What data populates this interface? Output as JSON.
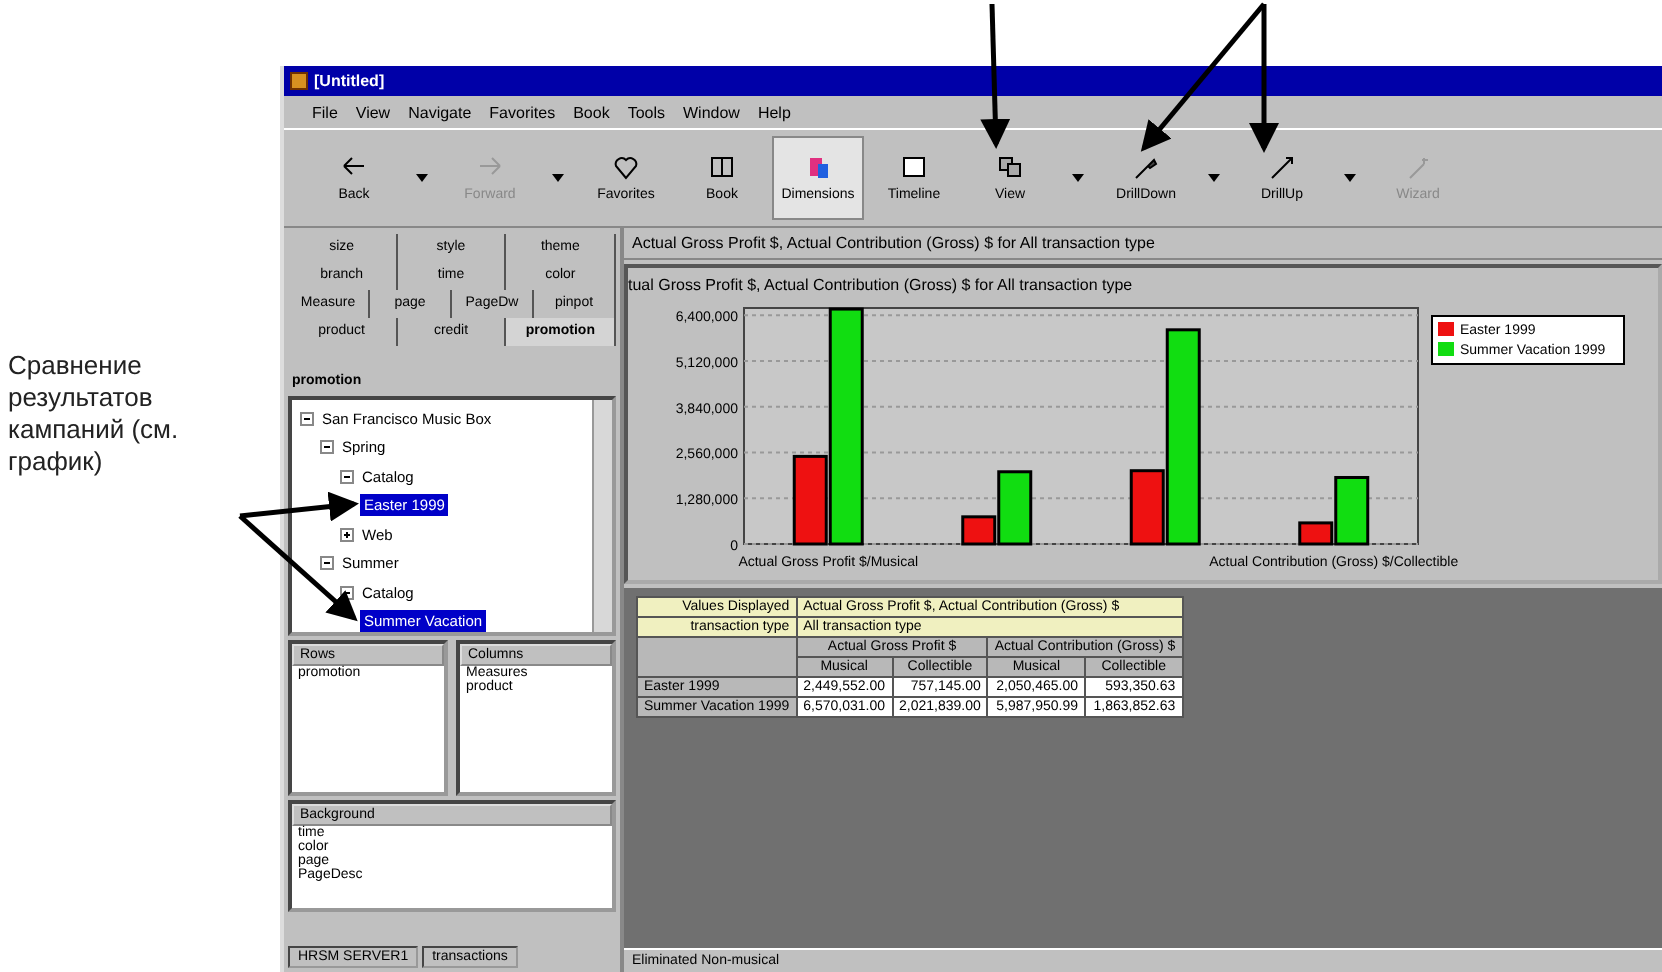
{
  "annotation": {
    "label": "Сравнение результатов кампаний (см. график)"
  },
  "window": {
    "title": "[Untitled]"
  },
  "menu": [
    "File",
    "View",
    "Navigate",
    "Favorites",
    "Book",
    "Tools",
    "Window",
    "Help"
  ],
  "toolbar": [
    {
      "label": "Back",
      "kind": "back",
      "disabled": false,
      "selected": false,
      "dropdown": true
    },
    {
      "label": "Forward",
      "kind": "forward",
      "disabled": true,
      "selected": false,
      "dropdown": true
    },
    {
      "label": "Favorites",
      "kind": "favorites",
      "disabled": false,
      "selected": false,
      "dropdown": false
    },
    {
      "label": "Book",
      "kind": "book",
      "disabled": false,
      "selected": false,
      "dropdown": false
    },
    {
      "label": "Dimensions",
      "kind": "dimensions",
      "disabled": false,
      "selected": true,
      "dropdown": false
    },
    {
      "label": "Timeline",
      "kind": "timeline",
      "disabled": false,
      "selected": false,
      "dropdown": false
    },
    {
      "label": "View",
      "kind": "view",
      "disabled": false,
      "selected": false,
      "dropdown": true
    },
    {
      "label": "DrillDown",
      "kind": "drilldown",
      "disabled": false,
      "selected": false,
      "dropdown": true
    },
    {
      "label": "DrillUp",
      "kind": "drillup",
      "disabled": false,
      "selected": false,
      "dropdown": true
    },
    {
      "label": "Wizard",
      "kind": "wizard",
      "disabled": true,
      "selected": false,
      "dropdown": false
    }
  ],
  "dimension_tabs": [
    [
      {
        "label": "size",
        "selected": false
      },
      {
        "label": "style",
        "selected": false
      },
      {
        "label": "theme",
        "selected": false
      }
    ],
    [
      {
        "label": "branch",
        "selected": false
      },
      {
        "label": "time",
        "selected": false
      },
      {
        "label": "color",
        "selected": false
      }
    ],
    [
      {
        "label": "Measure",
        "selected": false
      },
      {
        "label": "page",
        "selected": false
      },
      {
        "label": "PageDw",
        "selected": false
      },
      {
        "label": "pinpot",
        "selected": false
      }
    ],
    [
      {
        "label": "product",
        "selected": false
      },
      {
        "label": "credit",
        "selected": false
      },
      {
        "label": "promotion",
        "selected": true
      }
    ]
  ],
  "tree": {
    "title": "promotion",
    "items": [
      {
        "label": "San Francisco Music Box",
        "expanded": true,
        "selected": false,
        "children": [
          {
            "label": "Spring",
            "expanded": true,
            "selected": false,
            "children": [
              {
                "label": "Catalog",
                "expanded": true,
                "selected": false,
                "children": [
                  {
                    "label": "Easter 1999",
                    "selected": true
                  }
                ]
              },
              {
                "label": "Web",
                "expanded": false,
                "selected": false
              }
            ]
          },
          {
            "label": "Summer",
            "expanded": true,
            "selected": false,
            "children": [
              {
                "label": "Catalog",
                "expanded": true,
                "selected": false,
                "children": [
                  {
                    "label": "Summer Vacation",
                    "selected": true
                  }
                ]
              }
            ]
          }
        ]
      }
    ]
  },
  "rows_panel": {
    "title": "Rows",
    "items": [
      "promotion"
    ]
  },
  "columns_panel": {
    "title": "Columns",
    "items": [
      "Measures",
      "product"
    ]
  },
  "background_panel": {
    "title": "Background",
    "items": [
      "time",
      "color",
      "page",
      "PageDesc"
    ]
  },
  "status_left": [
    "HRSM SERVER1",
    "transactions"
  ],
  "report": {
    "header": "Actual Gross Profit $, Actual Contribution (Gross) $ for All transaction type",
    "chart_data": {
      "type": "bar",
      "title": "tual Gross Profit $, Actual Contribution (Gross) $ for All transaction type",
      "categories": [
        "Actual Gross Profit $/Musical",
        null,
        null,
        "Actual Contribution (Gross) $/Collectible"
      ],
      "ylim": [
        0,
        6600000
      ],
      "grid": true,
      "legend": true,
      "yticks": [
        {
          "value": 0,
          "label": "0"
        },
        {
          "value": 1280000,
          "label": "1,280,000"
        },
        {
          "value": 2560000,
          "label": "2,560,000"
        },
        {
          "value": 3840000,
          "label": "3,840,000"
        },
        {
          "value": 5120000,
          "label": "5,120,000"
        },
        {
          "value": 6400000,
          "label": "6,400,000"
        }
      ],
      "series": [
        {
          "name": "Easter 1999",
          "color": "#ee1111",
          "values": [
            2450000,
            760000,
            2050000,
            590000
          ]
        },
        {
          "name": "Summer Vacation 1999",
          "color": "#11dd11",
          "values": [
            6570000,
            2020000,
            5990000,
            1860000
          ]
        }
      ]
    },
    "table": {
      "info": [
        {
          "label": "Values Displayed",
          "value": "Actual Gross Profit $, Actual Contribution (Gross) $"
        },
        {
          "label": "transaction type",
          "value": "All transaction type"
        }
      ],
      "groups": [
        "Actual Gross Profit $",
        "Actual Contribution (Gross) $"
      ],
      "columns": [
        "Musical",
        "Collectible",
        "Musical",
        "Collectible"
      ],
      "rows": [
        {
          "name": "Easter 1999",
          "cells": [
            "2,449,552.00",
            "757,145.00",
            "2,050,465.00",
            "593,350.63"
          ]
        },
        {
          "name": "Summer Vacation 1999",
          "cells": [
            "6,570,031.00",
            "2,021,839.00",
            "5,987,950.99",
            "1,863,852.63"
          ]
        }
      ]
    },
    "status": "Eliminated Non-musical"
  }
}
